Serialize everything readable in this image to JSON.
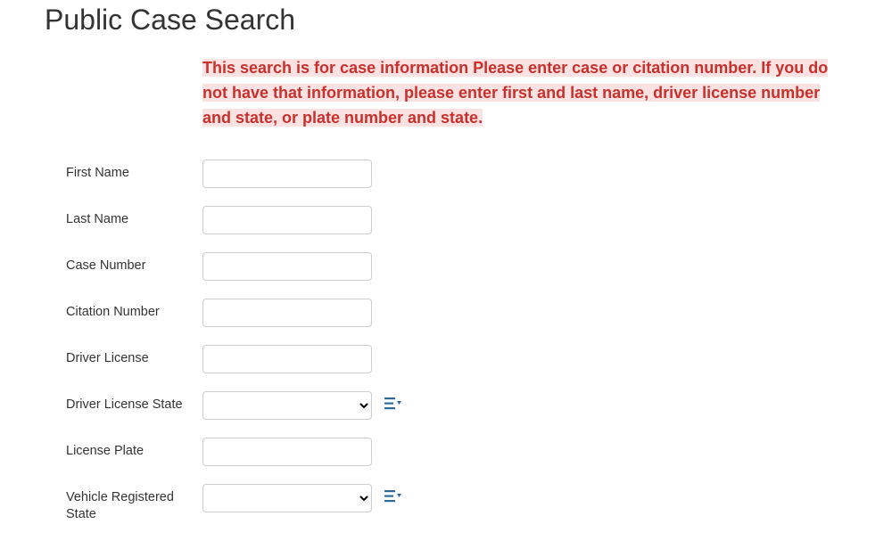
{
  "page": {
    "title": "Public Case Search",
    "instructions": "This search is for case information Please enter case or citation number. If you do not have that information, please enter first and last name, driver license number and state, or plate number and state."
  },
  "form": {
    "firstName": {
      "label": "First Name",
      "value": ""
    },
    "lastName": {
      "label": "Last Name",
      "value": ""
    },
    "caseNumber": {
      "label": "Case Number",
      "value": ""
    },
    "citationNumber": {
      "label": "Citation Number",
      "value": ""
    },
    "driverLicense": {
      "label": "Driver License",
      "value": ""
    },
    "driverLicenseState": {
      "label": "Driver License State",
      "value": ""
    },
    "licensePlate": {
      "label": "License Plate",
      "value": ""
    },
    "vehicleRegisteredState": {
      "label": "Vehicle Registered State",
      "value": ""
    }
  }
}
